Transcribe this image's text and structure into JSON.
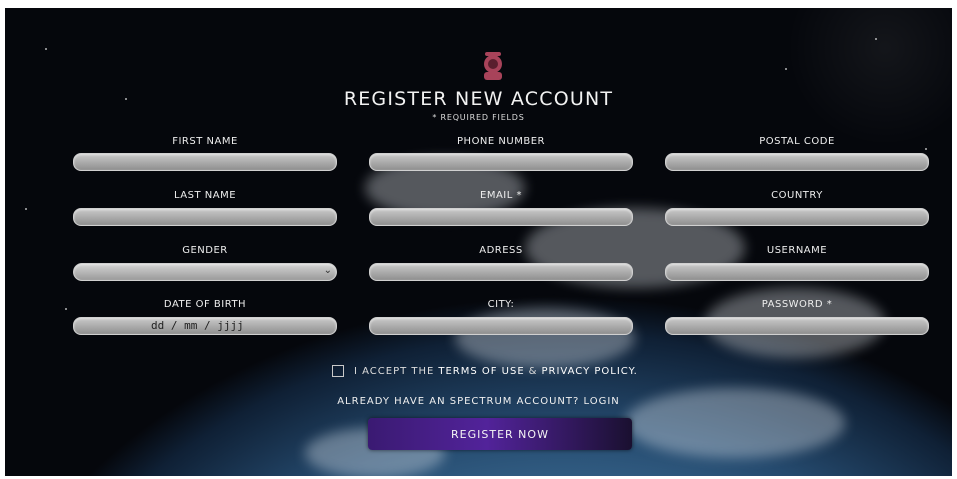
{
  "page": {
    "title": "REGISTER NEW ACCOUNT",
    "required_note": "* REQUIRED FIELDS"
  },
  "fields": {
    "first_name": "FIRST NAME",
    "last_name": "LAST NAME",
    "gender": "GENDER",
    "date_of_birth": "DATE OF BIRTH",
    "date_placeholder": "dd / mm / jjjj",
    "phone": "PHONE NUMBER",
    "email": "EMAIL *",
    "address": "ADRESS",
    "city": "CITY:",
    "postal_code": "POSTAL CODE",
    "country": "COUNTRY",
    "username": "USERNAME",
    "password": "PASSWORD *"
  },
  "terms": {
    "prefix": "I ACCEPT THE",
    "terms_link": "TERMS OF USE",
    "amp": "&",
    "privacy_link": "PRIVACY POLICY."
  },
  "login_text": "ALREADY HAVE AN SPECTRUM ACCOUNT? LOGIN",
  "register_button": "REGISTER NOW",
  "icons": {
    "logo": "astronaut-icon",
    "select": "chevron-down-icon"
  },
  "colors": {
    "button_start": "#3a1a72",
    "button_end": "#1a1030",
    "logo": "#a8435a"
  }
}
